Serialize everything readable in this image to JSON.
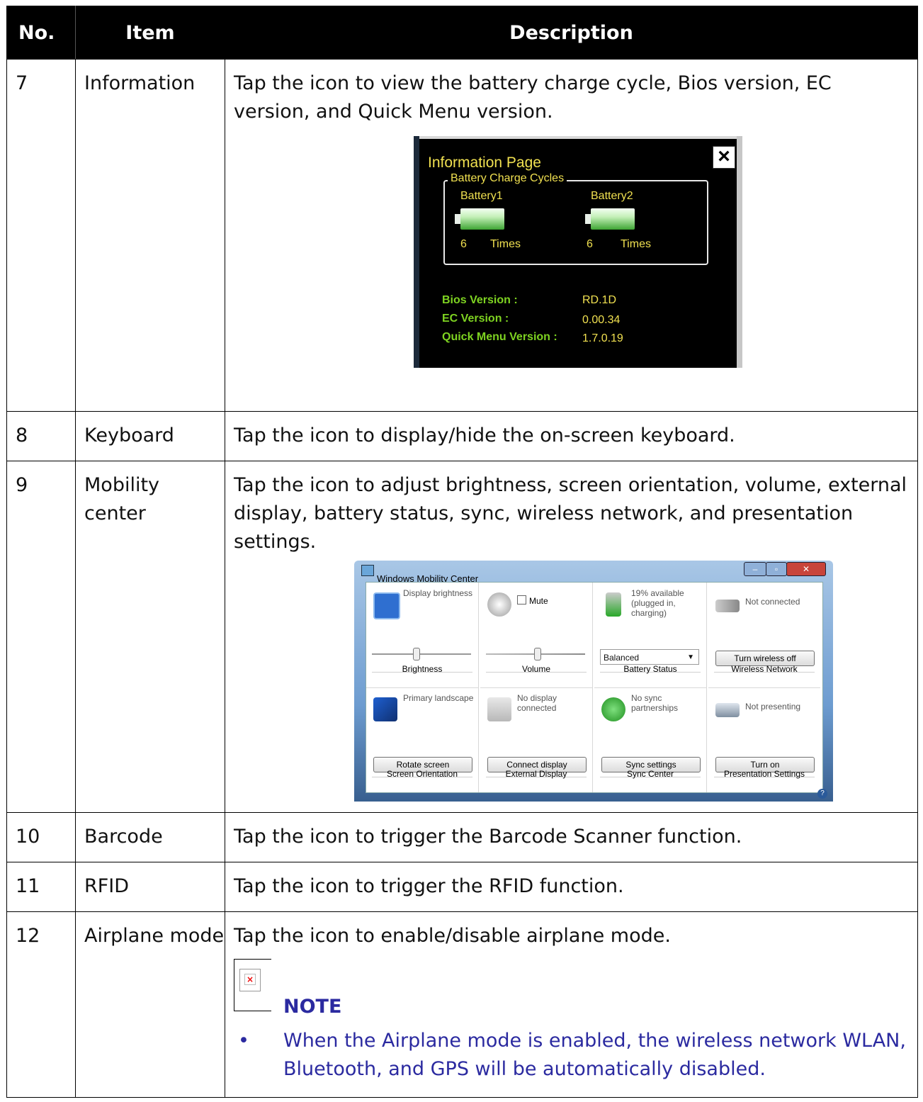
{
  "headers": {
    "no": "No.",
    "item": "Item",
    "description": "Description"
  },
  "rows": [
    {
      "no": "7",
      "item": "Information",
      "desc": "Tap the icon to view the battery charge cycle, Bios version, EC version, and Quick Menu version."
    },
    {
      "no": "8",
      "item": "Keyboard",
      "desc": "Tap the icon to display/hide the on-screen keyboard."
    },
    {
      "no": "9",
      "item": "Mobility center",
      "desc": "Tap the icon to adjust brightness, screen orientation, volume, external display, battery status, sync, wireless network, and presentation settings."
    },
    {
      "no": "10",
      "item": "Barcode",
      "desc": "Tap the icon to trigger the Barcode Scanner function."
    },
    {
      "no": "11",
      "item": "RFID",
      "desc": "Tap the icon to trigger the RFID function."
    },
    {
      "no": "12",
      "item": "Airplane mode",
      "desc": "Tap the icon to enable/disable airplane mode."
    }
  ],
  "info_page": {
    "title": "Information Page",
    "legend": "Battery Charge Cycles",
    "battery1": "Battery1",
    "battery2": "Battery2",
    "count1": "6",
    "count2": "6",
    "times": "Times",
    "bios_label": "Bios Version :",
    "bios_value": "RD.1D",
    "ec_label": "EC Version :",
    "ec_value": "0.00.34",
    "qm_label": "Quick Menu Version :",
    "qm_value": "1.7.0.19",
    "close": "×"
  },
  "mobility": {
    "title": "Windows Mobility Center",
    "tiles": {
      "brightness": {
        "text": "Display brightness",
        "caption": "Brightness"
      },
      "volume": {
        "text": "Mute",
        "caption": "Volume"
      },
      "battery": {
        "text": "19% available (plugged in, charging)",
        "select": "Balanced",
        "caption": "Battery Status"
      },
      "wireless": {
        "text": "Not connected",
        "button": "Turn wireless off",
        "caption": "Wireless Network"
      },
      "orientation": {
        "text": "Primary landscape",
        "button": "Rotate screen",
        "caption": "Screen Orientation"
      },
      "display": {
        "text": "No display connected",
        "button": "Connect display",
        "caption": "External Display"
      },
      "sync": {
        "text": "No sync partnerships",
        "button": "Sync settings",
        "caption": "Sync Center"
      },
      "presentation": {
        "text": "Not presenting",
        "button": "Turn on",
        "caption": "Presentation Settings"
      }
    }
  },
  "note": {
    "title": "NOTE",
    "items": [
      "When the Airplane mode is enabled, the wireless network WLAN, Bluetooth, and GPS will be automatically disabled."
    ]
  },
  "colors": {
    "header_bg": "#000000",
    "note_text": "#2b2aa0",
    "info_yellow": "#f0e050",
    "info_green": "#7ed321"
  }
}
